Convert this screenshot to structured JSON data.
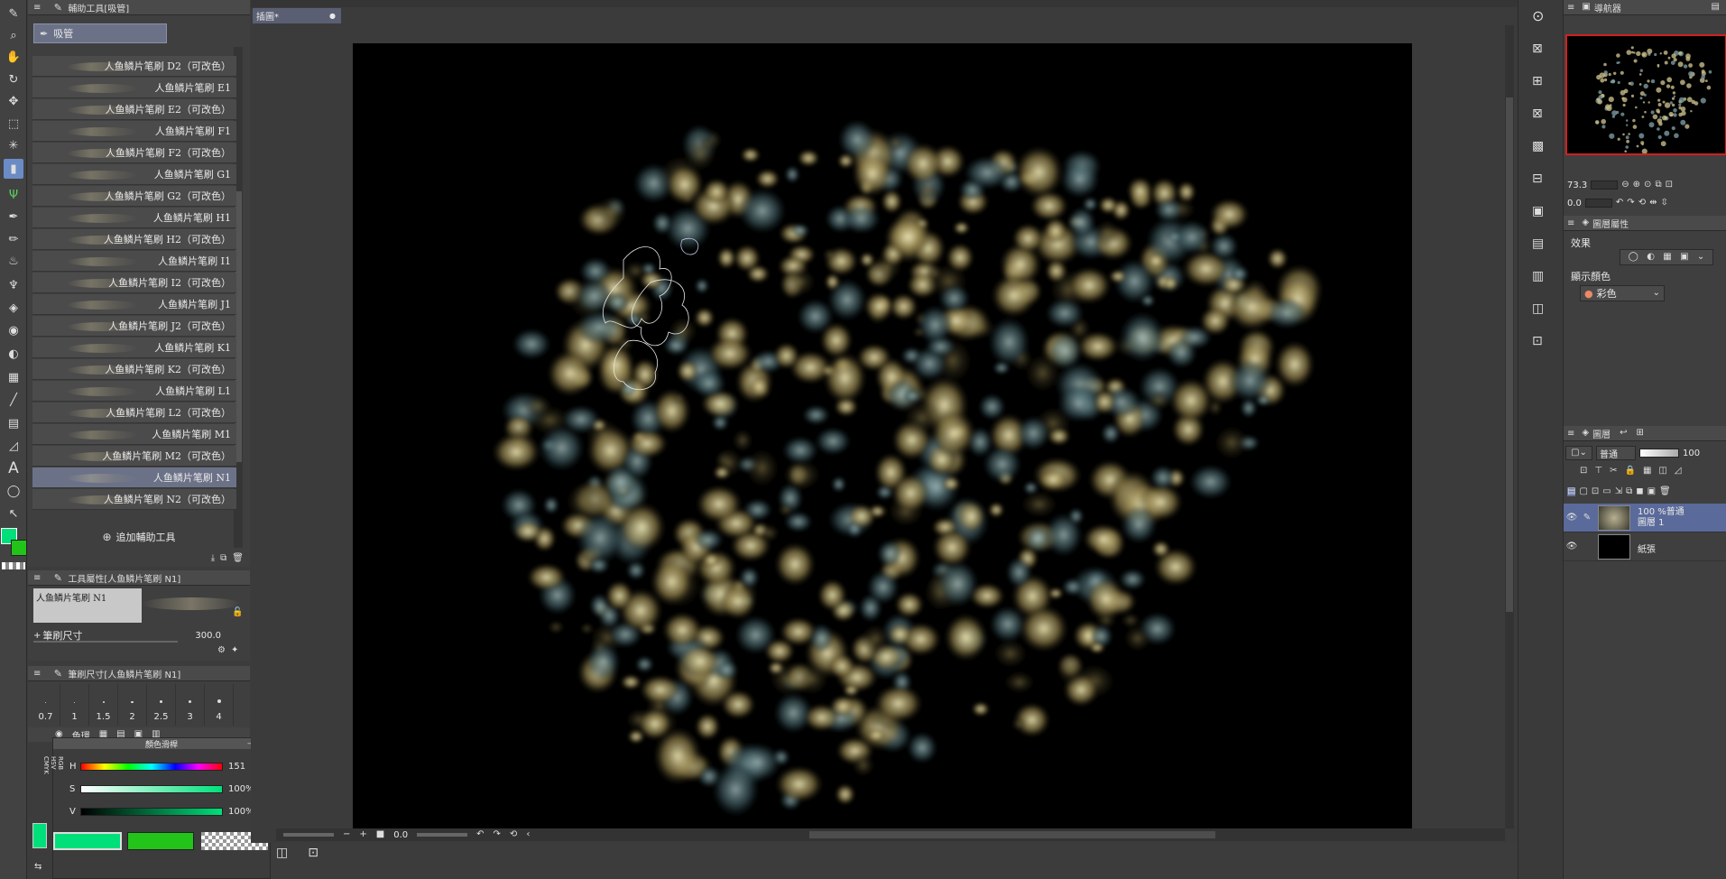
{
  "toolbar": {
    "icons": [
      "brush",
      "magnifier",
      "hand",
      "rotate",
      "move",
      "marquee",
      "wand",
      "gradient-tool",
      "grass",
      "pen",
      "pencil",
      "airbrush",
      "decoration",
      "eraser",
      "blend",
      "fill",
      "gradient",
      "line",
      "frame",
      "ruler",
      "text",
      "lasso",
      "correct-line"
    ]
  },
  "subtool_panel": {
    "title": "輔助工具[吸管]",
    "active_tool": "吸管",
    "brushes": [
      {
        "label": "人鱼鳞片笔刷 D2（可改色）"
      },
      {
        "label": "人鱼鳞片笔刷 E1"
      },
      {
        "label": "人鱼鳞片笔刷 E2（可改色）"
      },
      {
        "label": "人鱼鳞片笔刷 F1"
      },
      {
        "label": "人鱼鳞片笔刷 F2（可改色）"
      },
      {
        "label": "人鱼鳞片笔刷 G1"
      },
      {
        "label": "人鱼鳞片笔刷 G2（可改色）"
      },
      {
        "label": "人鱼鳞片笔刷 H1"
      },
      {
        "label": "人鱼鳞片笔刷 H2（可改色）"
      },
      {
        "label": "人鱼鳞片笔刷 I1"
      },
      {
        "label": "人鱼鳞片笔刷 I2（可改色）"
      },
      {
        "label": "人鱼鳞片笔刷 J1"
      },
      {
        "label": "人鱼鳞片笔刷 J2（可改色）"
      },
      {
        "label": "人鱼鳞片笔刷 K1"
      },
      {
        "label": "人鱼鳞片笔刷 K2（可改色）"
      },
      {
        "label": "人鱼鳞片笔刷 L1"
      },
      {
        "label": "人鱼鳞片笔刷 L2（可改色）"
      },
      {
        "label": "人鱼鳞片笔刷 M1"
      },
      {
        "label": "人鱼鳞片笔刷 M2（可改色）"
      },
      {
        "label": "人鱼鳞片笔刷 N1"
      },
      {
        "label": "人鱼鳞片笔刷 N2（可改色）"
      }
    ],
    "selected_index": 19,
    "add_label": "追加輔助工具"
  },
  "tool_property": {
    "title": "工具屬性[人鱼鳞片笔刷 N1]",
    "brush_name": "人鱼鳞片笔刷 N1",
    "size_label": "筆刷尺寸",
    "size_value": "300.0"
  },
  "brush_size": {
    "title": "筆刷尺寸[人鱼鳞片笔刷 N1]",
    "sizes": [
      "0.7",
      "1",
      "1.5",
      "2",
      "2.5",
      "3",
      "4"
    ]
  },
  "color_panel": {
    "tab_label": "色環",
    "title": "顏色滑桿",
    "modes": [
      "RGB",
      "HSV",
      "CMYK"
    ],
    "h_label": "H",
    "h_value": "151",
    "s_label": "S",
    "s_value": "100%",
    "v_label": "V",
    "v_value": "100%",
    "main_color": "#00e07a",
    "sub_color": "#22c41a"
  },
  "canvas": {
    "tab_label": "插圖*",
    "zoom": "0.0",
    "bg_color": "#000000"
  },
  "navigator": {
    "title": "導航器",
    "zoom": "73.3",
    "rotation": "0.0"
  },
  "layer_property": {
    "title": "圖層屬性",
    "effect_label": "效果",
    "display_color_label": "顯示顏色",
    "display_color_value": "彩色"
  },
  "layers_panel": {
    "title": "圖層",
    "blend_mode": "普通",
    "opacity": "100",
    "layers": [
      {
        "meta": "100 %普通",
        "name": "圖層 1",
        "selected": true
      },
      {
        "meta": "",
        "name": "紙張",
        "selected": false
      }
    ]
  }
}
